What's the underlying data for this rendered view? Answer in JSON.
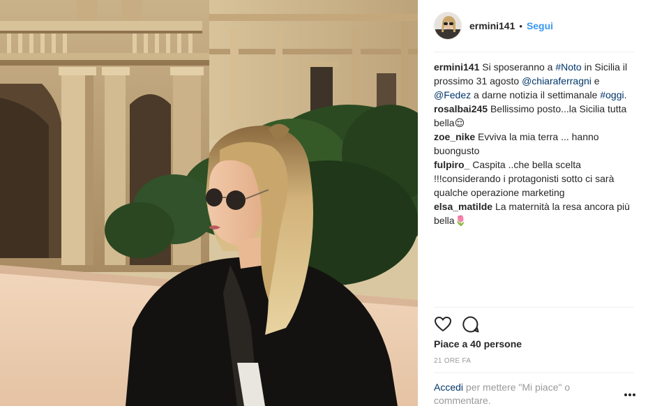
{
  "post": {
    "author": "ermini141",
    "separator": "•",
    "follow_label": "Segui",
    "caption": {
      "user": "ermini141",
      "parts": [
        {
          "t": "Si sposeranno a ",
          "link": false
        },
        {
          "t": "#Noto",
          "link": true
        },
        {
          "t": " in Sicilia il prossimo 31 agosto ",
          "link": false
        },
        {
          "t": "@chiaraferragni",
          "link": true
        },
        {
          "t": " e ",
          "link": false
        },
        {
          "t": "@Fedez",
          "link": true
        },
        {
          "t": " a darne notizia il settimanale ",
          "link": false
        },
        {
          "t": "#oggi",
          "link": true
        },
        {
          "t": ".",
          "link": false
        }
      ]
    },
    "comments": [
      {
        "user": "rosalbai245",
        "text": "Bellissimo posto...la Sicilia tutta bella😌"
      },
      {
        "user": "zoe_nike",
        "text": "Evviva la mia terra ... hanno buongusto"
      },
      {
        "user": "fulpiro_",
        "text": "Caspita ..che bella scelta !!!considerando i protagonisti sotto ci sarà qualche operazione marketing"
      },
      {
        "user": "elsa_matilde",
        "text": "La maternità la resa ancora più bella🌷"
      }
    ],
    "likes_text": "Piace a 40 persone",
    "time_text": "21 ORE FA",
    "footer": {
      "login_label": "Accedi",
      "text": " per mettere \"Mi piace\" o commentare."
    },
    "icons": {
      "like": "heart-icon",
      "comment": "comment-icon",
      "more": "more-options-icon"
    },
    "colors": {
      "link": "#003569",
      "follow": "#3897f0",
      "muted": "#999999",
      "text": "#262626"
    }
  }
}
